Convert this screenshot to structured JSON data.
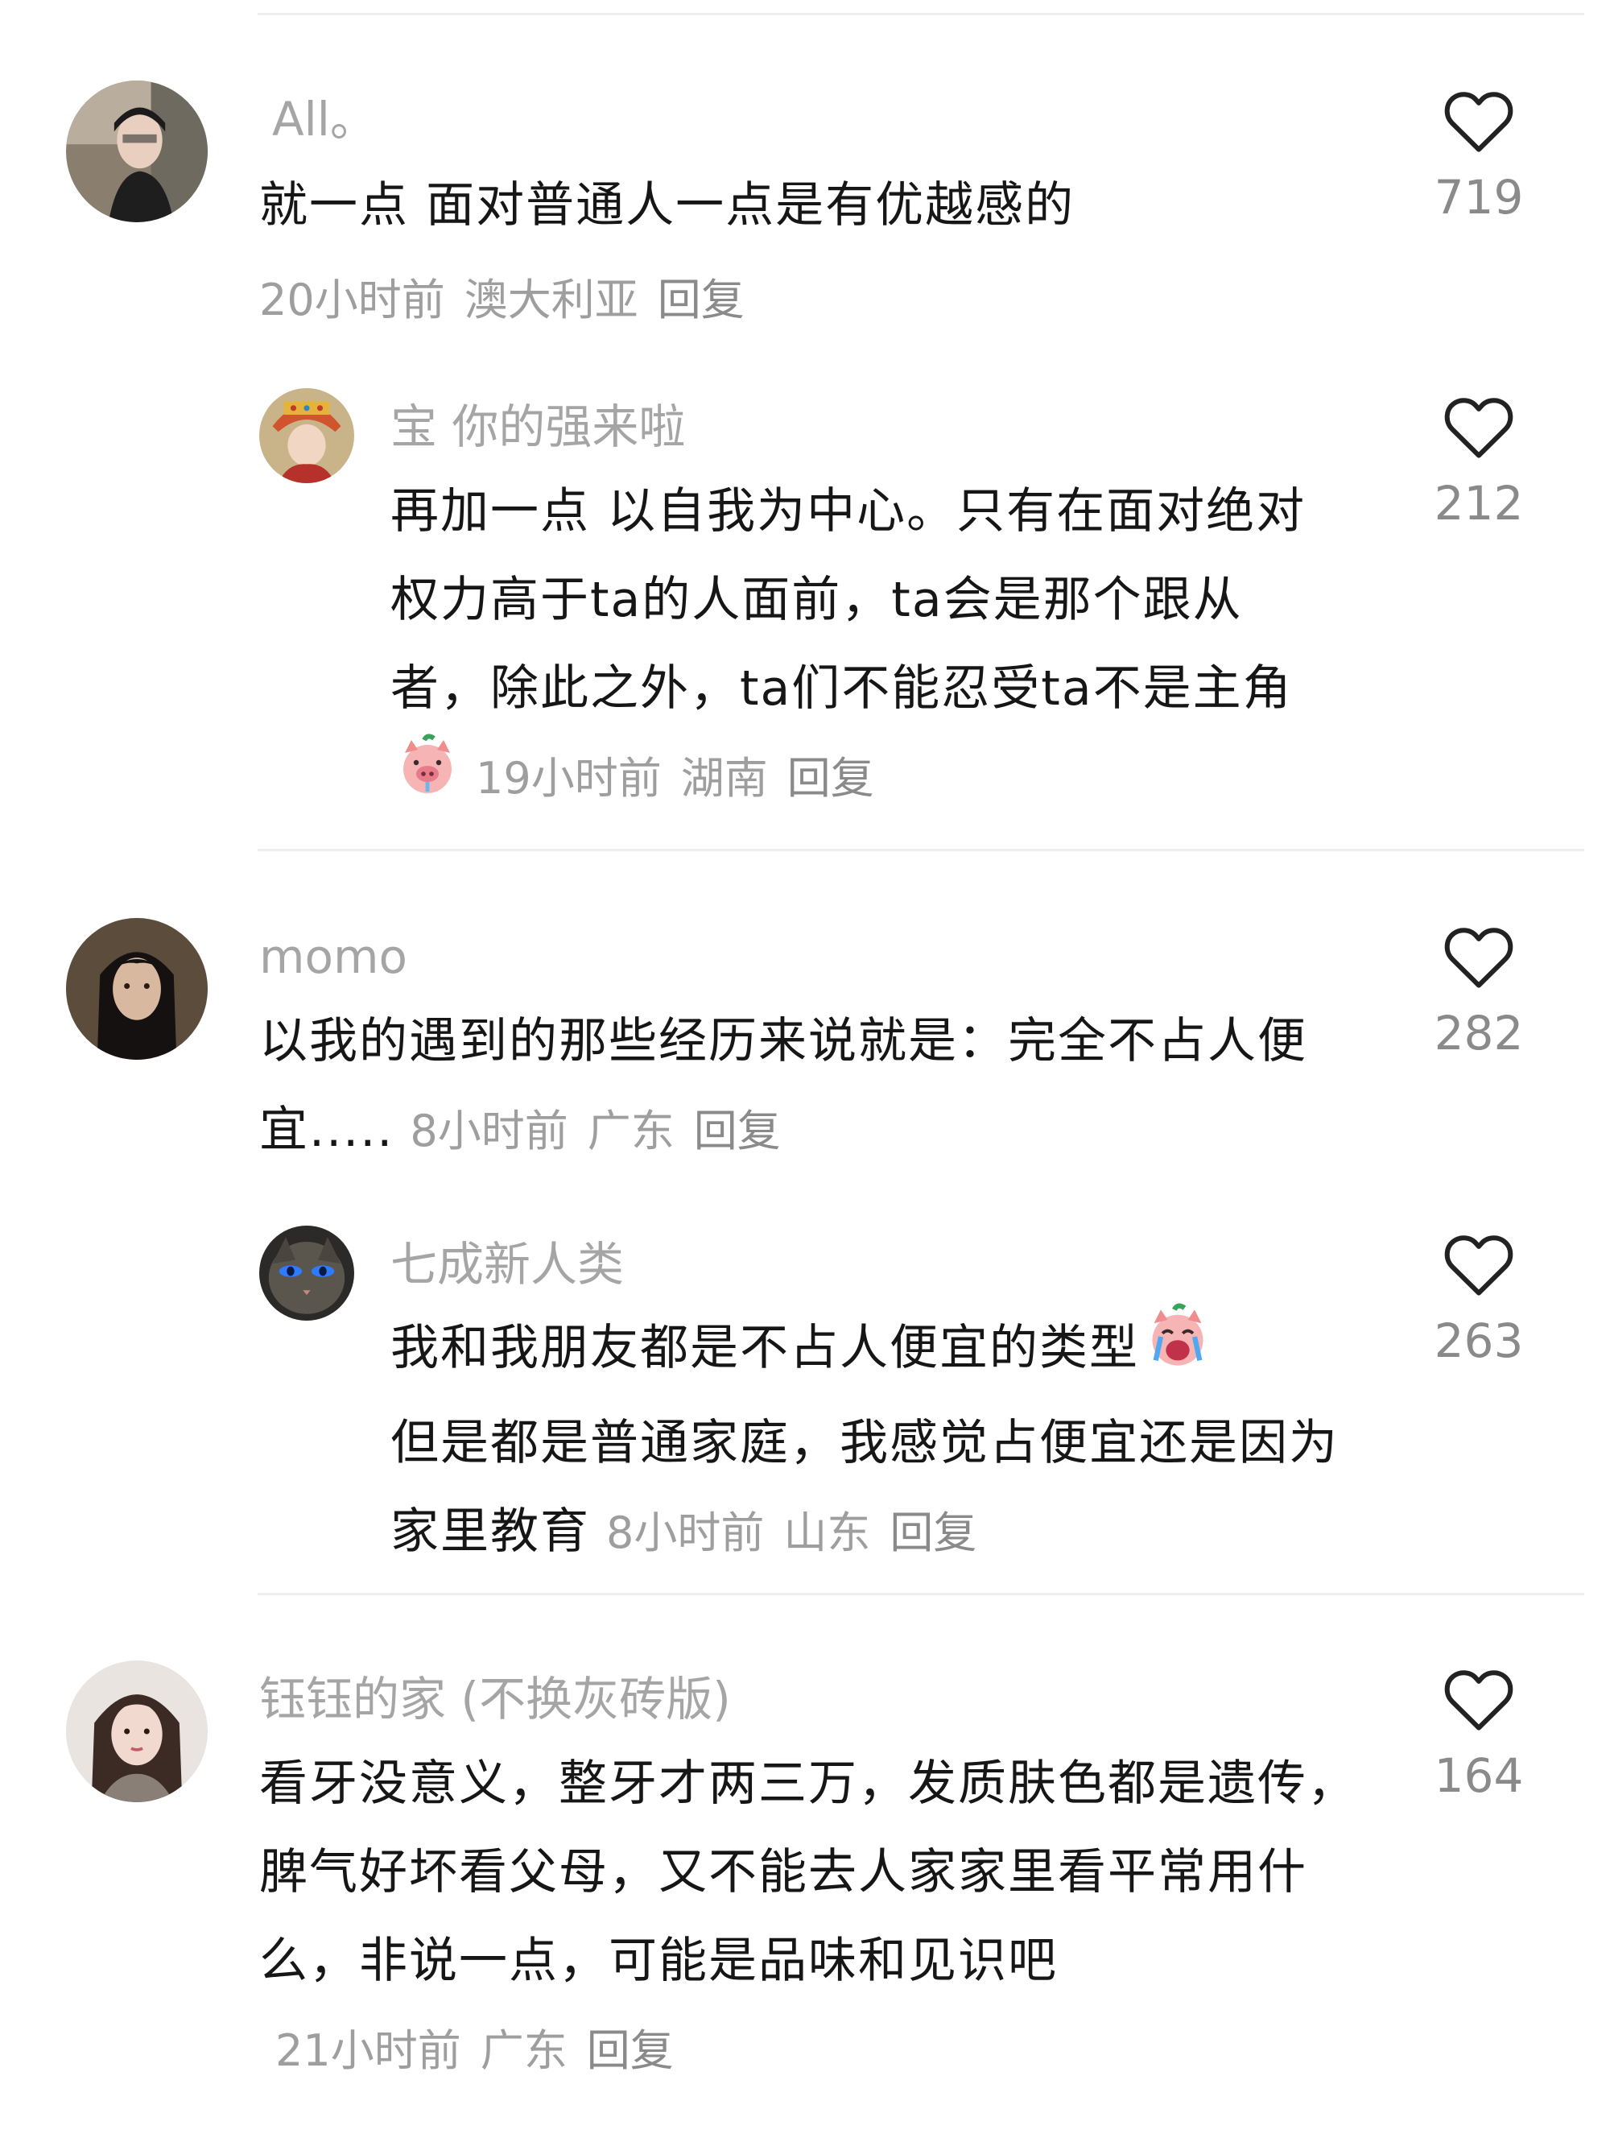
{
  "comments": [
    {
      "username": "All。",
      "text": "就一点 面对普通人一点是有优越感的",
      "time": "20小时前",
      "location": "澳大利亚",
      "reply_label": "回复",
      "likes": "719",
      "replies": [
        {
          "username": "宝 你的强来啦",
          "text": "再加一点 以自我为中心。只有在面对绝对权力高于ta的人面前，ta会是那个跟从者，除此之外，ta们不能忍受ta不是主角",
          "emoji": "pig-face-emoji",
          "time": "19小时前",
          "location": "湖南",
          "reply_label": "回复",
          "likes": "212"
        }
      ]
    },
    {
      "username": "momo",
      "text": "以我的遇到的那些经历来说就是：完全不占人便宜.....",
      "time": "8小时前",
      "location": "广东",
      "reply_label": "回复",
      "likes": "282",
      "replies": [
        {
          "username": "七成新人类",
          "text_line1": "我和我朋友都是不占人便宜的类型",
          "emoji": "crying-face-emoji",
          "text_rest": "但是都是普通家庭，我感觉占便宜还是因为家里教育",
          "time": "8小时前",
          "location": "山东",
          "reply_label": "回复",
          "likes": "263"
        }
      ]
    },
    {
      "username": "钰钰的家 (不换灰砖版)",
      "text": "看牙没意义，整牙才两三万，发质肤色都是遗传，脾气好坏看父母，又不能去人家家里看平常用什么，非说一点，可能是品味和见识吧",
      "time": "21小时前",
      "location": "广东",
      "reply_label": "回复",
      "likes": "164"
    }
  ],
  "icons": {
    "like": "heart-outline-icon"
  },
  "colors": {
    "username": "#a5a5a5",
    "text": "#161616",
    "meta": "#9e9e9e",
    "divider": "#eeeeee"
  }
}
